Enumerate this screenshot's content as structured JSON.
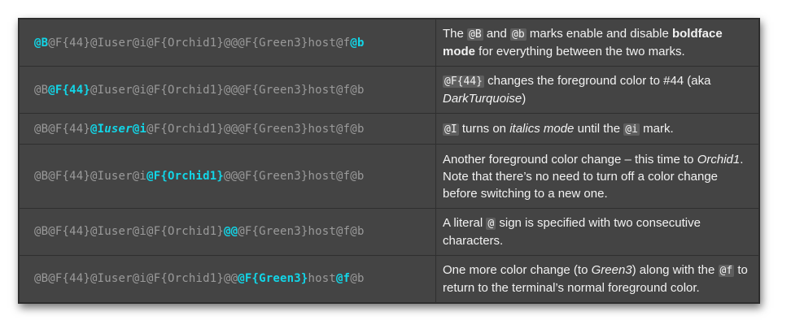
{
  "rows": [
    {
      "code": [
        "@B",
        "@F{44}@Iuser@i@F{Orchid1}@@@F{Green3}host@f",
        "@b"
      ],
      "desc": {
        "t1": "The ",
        "c1": "@B",
        "t2": " and ",
        "c2": "@b",
        "t3": " marks enable and disable ",
        "b1": "boldface mode",
        "t4": " for everything between the two marks."
      }
    },
    {
      "code": [
        "@B",
        "@F{44}",
        "@Iuser@i@F{Orchid1}@@@F{Green3}host@f@b"
      ],
      "desc": {
        "c1": "@F{44}",
        "t1": " changes the foreground color to #44 (aka ",
        "e1": "DarkTurquoise",
        "t2": ")"
      }
    },
    {
      "code": [
        "@B@F{44}",
        "@I",
        "user",
        "@i",
        "@F{Orchid1}@@@F{Green3}host@f@b"
      ],
      "desc": {
        "c1": "@I",
        "t1": " turns on ",
        "e1": "italics mode",
        "t2": " until the ",
        "c2": "@i",
        "t3": " mark."
      }
    },
    {
      "code": [
        "@B@F{44}@Iuser@i",
        "@F{Orchid1}",
        "@@@F{Green3}host@f@b"
      ],
      "desc": {
        "t1": "Another foreground color change – this time to ",
        "e1": "Orchid1",
        "t2": ". Note that there’s no need to turn off a color change before switching to a new one."
      }
    },
    {
      "code": [
        "@B@F{44}@Iuser@i@F{Orchid1}",
        "@@",
        "@F{Green3}host@f@b"
      ],
      "desc": {
        "t1": "A literal ",
        "c1": "@",
        "t2": " sign is specified with two consecutive characters."
      }
    },
    {
      "code": [
        "@B@F{44}@Iuser@i@F{Orchid1}@@",
        "@F{Green3}",
        "host",
        "@f",
        "@b"
      ],
      "desc": {
        "t1": "One more color change (to ",
        "e1": "Green3",
        "t2": ") along with the ",
        "c1": "@f",
        "t3": " to return to the terminal’s normal foreground color."
      }
    }
  ],
  "colors": {
    "highlight": "#12d6e8",
    "code_dim": "#9a9a9a",
    "background": "#444444",
    "text": "#f2f2f2"
  }
}
